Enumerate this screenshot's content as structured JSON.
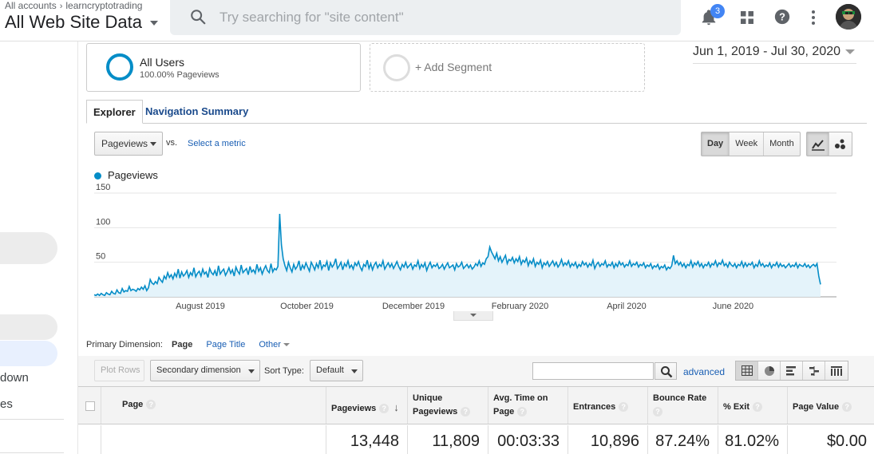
{
  "header": {
    "breadcrumb_root": "All accounts",
    "breadcrumb_account": "learncryptotrading",
    "property_view": "All Web Site Data",
    "search_placeholder": "Try searching for \"site content\"",
    "notification_count": "3"
  },
  "leftnav": {
    "items": [
      "down",
      "es"
    ]
  },
  "segments": {
    "active_name": "All Users",
    "active_sub": "100.00% Pageviews",
    "add_label": "+ Add Segment"
  },
  "date_range": "Jun 1, 2019 - Jul 30, 2020",
  "tabs": [
    {
      "label": "Explorer"
    },
    {
      "label": "Navigation Summary"
    }
  ],
  "chart_controls": {
    "metric": "Pageviews",
    "vs": "vs.",
    "select_metric": "Select a metric",
    "granularity": [
      {
        "label": "Day",
        "selected": true
      },
      {
        "label": "Week",
        "selected": false
      },
      {
        "label": "Month",
        "selected": false
      }
    ],
    "chart_types": [
      "line-chart-icon",
      "motion-chart-icon"
    ]
  },
  "chart_data": {
    "type": "line",
    "series": [
      {
        "name": "Pageviews",
        "color": "#058dc7",
        "values": [
          3,
          2,
          4,
          2,
          5,
          3,
          2,
          6,
          4,
          3,
          8,
          5,
          4,
          10,
          6,
          5,
          12,
          7,
          9,
          8,
          15,
          9,
          11,
          10,
          8,
          12,
          10,
          14,
          11,
          16,
          9,
          13,
          25,
          20,
          18,
          22,
          19,
          28,
          24,
          21,
          30,
          26,
          35,
          28,
          32,
          26,
          34,
          29,
          40,
          27,
          36,
          30,
          33,
          38,
          28,
          35,
          31,
          42,
          29,
          34,
          37,
          30,
          40,
          33,
          36,
          28,
          41,
          35,
          32,
          38,
          30,
          45,
          33,
          37,
          40,
          31,
          36,
          42,
          34,
          39,
          30,
          43,
          37,
          33,
          46,
          35,
          38,
          41,
          32,
          44,
          36,
          39,
          34,
          47,
          37,
          42,
          33,
          40,
          45,
          38,
          35,
          48,
          36,
          41,
          39,
          44,
          120,
          75,
          55,
          45,
          38,
          50,
          42,
          36,
          47,
          40,
          44,
          52,
          38,
          46,
          41,
          49,
          43,
          37,
          50,
          45,
          39,
          48,
          42,
          53,
          40,
          46,
          44,
          51,
          38,
          49,
          43,
          47,
          55,
          41,
          45,
          50,
          39,
          48,
          44,
          52,
          42,
          46,
          40,
          49,
          45,
          51,
          43,
          38,
          47,
          44,
          53,
          41,
          48,
          39,
          46,
          50,
          42,
          47,
          44,
          52,
          40,
          45,
          49,
          43,
          48,
          41,
          46,
          51,
          44,
          39,
          47,
          43,
          50,
          42,
          45,
          48,
          40,
          46,
          44,
          52,
          41,
          47,
          43,
          49,
          38,
          45,
          50,
          42,
          46,
          44,
          48,
          41,
          43,
          47,
          40,
          45,
          49,
          42,
          44,
          46,
          39,
          48,
          43,
          45,
          50,
          41,
          44,
          47,
          42,
          46,
          40,
          43,
          48,
          45,
          52,
          44,
          49,
          47,
          55,
          58,
          72,
          65,
          60,
          55,
          63,
          52,
          58,
          50,
          55,
          60,
          48,
          54,
          52,
          57,
          49,
          55,
          51,
          58,
          47,
          53,
          50,
          56,
          45,
          52,
          48,
          55,
          44,
          50,
          47,
          53,
          42,
          49,
          46,
          51,
          44,
          48,
          52,
          45,
          50,
          43,
          47,
          54,
          45,
          49,
          46,
          52,
          43,
          48,
          45,
          50,
          42,
          47,
          44,
          51,
          46,
          49,
          43,
          48,
          45,
          53,
          41,
          47,
          50,
          44,
          48,
          46,
          52,
          43,
          47,
          45,
          50,
          42,
          48,
          44,
          51,
          46,
          49,
          43,
          47,
          45,
          52,
          44,
          48,
          46,
          50,
          43,
          47,
          45,
          49,
          42,
          46,
          44,
          48,
          41,
          45,
          43,
          47,
          40,
          44,
          42,
          46,
          39,
          43,
          41,
          45,
          60,
          48,
          52,
          46,
          50,
          44,
          48,
          42,
          47,
          45,
          52,
          43,
          49,
          46,
          51,
          44,
          48,
          42,
          47,
          45,
          50,
          43,
          48,
          46,
          52,
          44,
          49,
          47,
          53,
          45,
          48,
          43,
          50,
          46,
          44,
          48,
          42,
          47,
          45,
          51,
          43,
          49,
          44,
          48,
          46,
          50,
          42,
          47,
          44,
          52,
          45,
          48,
          43,
          46,
          44,
          49,
          42,
          47,
          45,
          50,
          43,
          48,
          44,
          46,
          42,
          45,
          48,
          43,
          46,
          44,
          49,
          42,
          47,
          45,
          44,
          48,
          43,
          46,
          42,
          45,
          47,
          44,
          48,
          30,
          18
        ]
      }
    ],
    "ylim": [
      0,
      150
    ],
    "yticks": [
      50,
      100,
      150
    ],
    "xticks": [
      "August 2019",
      "October 2019",
      "December 2019",
      "February 2020",
      "April 2020",
      "June 2020"
    ],
    "grid": true,
    "legend": "top-left"
  },
  "primary_dimension": {
    "label": "Primary Dimension:",
    "current": "Page",
    "options": [
      "Page Title",
      "Other"
    ]
  },
  "table_toolbar": {
    "plot_rows": "Plot Rows",
    "secondary_dimension": "Secondary dimension",
    "sort_type_label": "Sort Type:",
    "sort_type_value": "Default",
    "advanced": "advanced",
    "views": [
      "table-view-icon",
      "pie-view-icon",
      "performance-view-icon",
      "comparison-view-icon",
      "pivot-view-icon"
    ]
  },
  "table": {
    "columns": [
      "Page",
      "Pageviews",
      "Unique Pageviews",
      "Avg. Time on Page",
      "Entrances",
      "Bounce Rate",
      "% Exit",
      "Page Value"
    ],
    "totals": [
      "13,448",
      "11,809",
      "00:03:33",
      "10,896",
      "87.24%",
      "81.02%",
      "$0.00"
    ]
  }
}
